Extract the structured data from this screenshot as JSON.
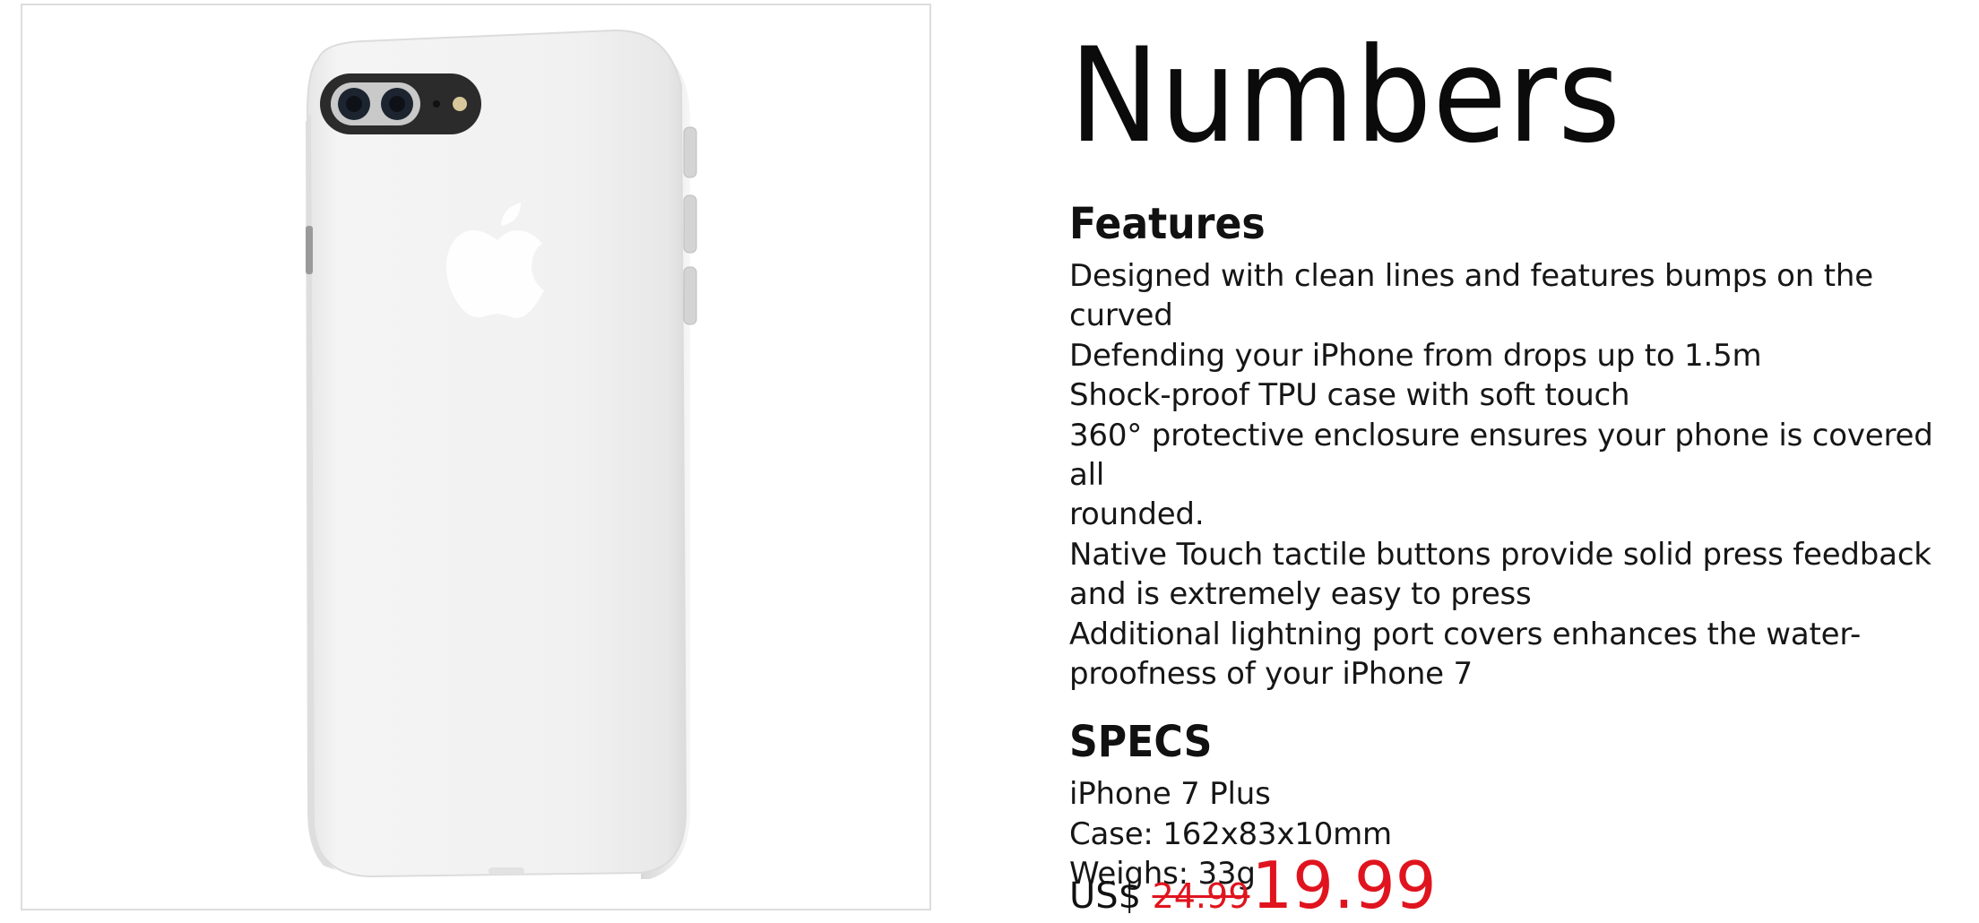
{
  "product": {
    "image_alt": "Translucent white iPhone 7 Plus case",
    "title": "Numbers"
  },
  "features": {
    "heading": "Features",
    "lines": [
      "Designed with clean lines and features bumps on the",
      "curved",
      "Defending your iPhone from drops up to 1.5m",
      "Shock-proof TPU case with soft touch",
      "360° protective enclosure ensures your phone is covered all",
      "rounded.",
      "Native Touch tactile buttons provide solid press feedback",
      "and is extremely easy to press",
      "Additional lightning port covers enhances the water-",
      "proofness of your iPhone 7"
    ]
  },
  "specs": {
    "heading": "SPECS",
    "lines": [
      "iPhone 7 Plus",
      "Case: 162x83x10mm",
      "Weighs: 33g"
    ]
  },
  "price": {
    "currency": "US$",
    "original": "24.99",
    "sale": "19.99"
  },
  "colors": {
    "sale_red": "#e0141e",
    "frame_border": "#dddddd",
    "case_white": "#f1f1f1"
  }
}
